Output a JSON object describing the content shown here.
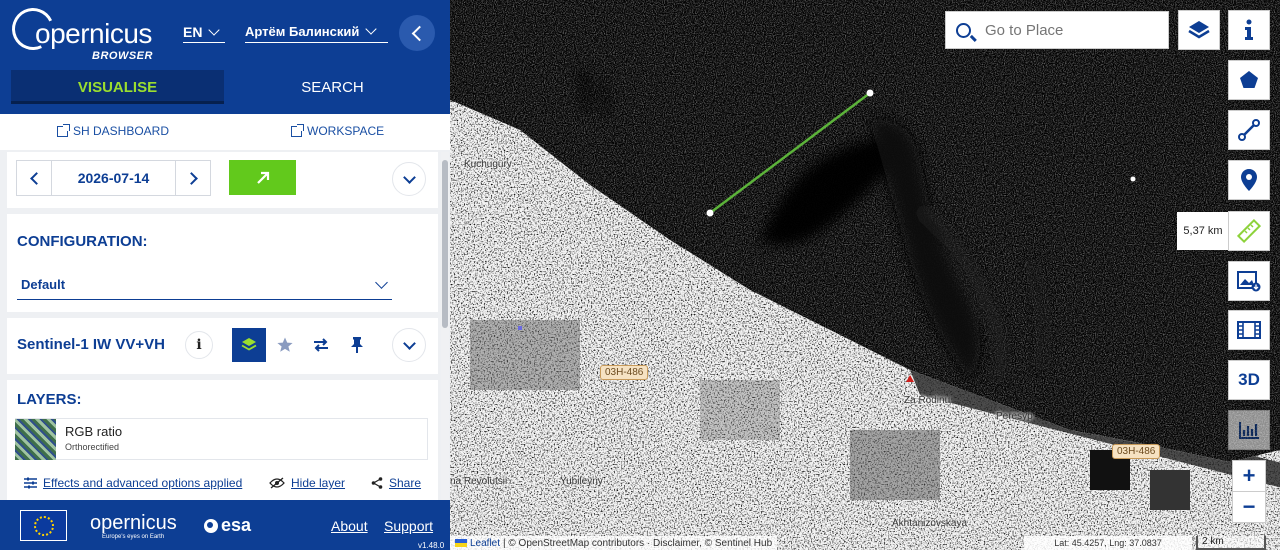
{
  "sidebar": {
    "logo": {
      "main": "opernicus",
      "sub": "BROWSER"
    },
    "language": "EN",
    "user_name": "Артём Балинский",
    "tabs": [
      {
        "label": "VISUALISE",
        "active": true
      },
      {
        "label": "SEARCH",
        "active": false
      }
    ],
    "links": {
      "dashboard": "SH DASHBOARD",
      "workspace": "WORKSPACE"
    },
    "date": "2026-07-14",
    "configuration": {
      "title": "CONFIGURATION:",
      "selected": "Default"
    },
    "dataset": {
      "title": "Sentinel-1 IW VV+VH",
      "info": "i"
    },
    "layers": {
      "title": "LAYERS:",
      "items": [
        {
          "name": "RGB ratio",
          "subtitle": "Orthorectified"
        }
      ]
    },
    "options": {
      "effects": "Effects and advanced options applied",
      "hide": "Hide layer",
      "share": "Share"
    },
    "footer": {
      "logo": "opernicus",
      "logo_sub": "Europe's eyes on Earth",
      "esa": "esa",
      "about": "About",
      "support": "Support",
      "version": "v1.48.0"
    }
  },
  "map": {
    "search_placeholder": "Go to Place",
    "measure_distance": "5,37 km",
    "labels": {
      "kuchugury": "Kuchugury",
      "za_rodinu": "Za Rodinu",
      "peresyp": "Peresyp",
      "revolutsii": "na Revolutsii",
      "yubileyny": "Yubileyny",
      "akhtanizovskaya": "Akhtanizovskaya"
    },
    "roads": {
      "a": "03Н-486",
      "b": "03Н-486"
    },
    "zoom_in": "+",
    "zoom_out": "−",
    "btn_3d": "3D",
    "attribution": {
      "leaflet": "Leaflet",
      "rest": "| © OpenStreetMap contributors · Disclaimer, © Sentinel Hub"
    },
    "coordinates": "Lat: 45.4257, Lng: 37.0837",
    "scale": "2 km"
  },
  "colors": {
    "brand_blue": "#0d3e94",
    "accent_green": "#62c91c",
    "tab_active_text": "#9bde2f"
  }
}
